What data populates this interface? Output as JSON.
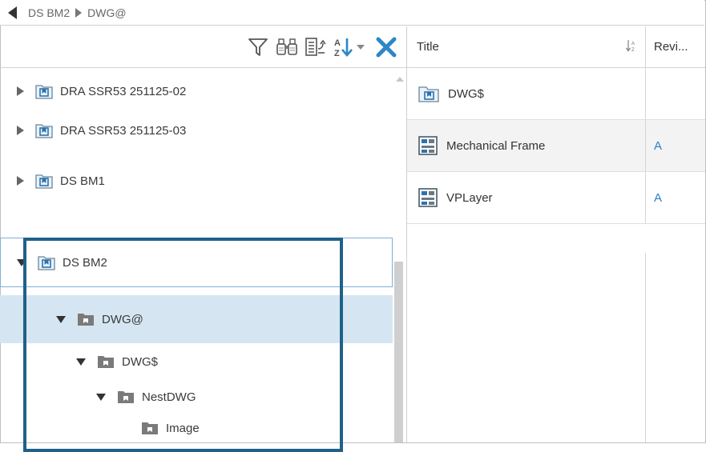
{
  "breadcrumb": {
    "items": [
      "DS BM2",
      "DWG@"
    ]
  },
  "toolbar": {
    "icons": [
      "filter-icon",
      "find-icon",
      "expand-icon",
      "sort-az-icon",
      "clear-icon"
    ]
  },
  "tree": {
    "nodes": [
      {
        "label": "DRA SSR53 251125-02",
        "expanded": false
      },
      {
        "label": "DRA SSR53 251125-03",
        "expanded": false
      },
      {
        "label": "DS BM1",
        "expanded": false
      },
      {
        "label": "DS BM2",
        "expanded": true
      },
      {
        "label": "DWG@",
        "expanded": true
      },
      {
        "label": "DWG$",
        "expanded": true
      },
      {
        "label": "NestDWG",
        "expanded": true
      },
      {
        "label": "Image",
        "expanded": false
      }
    ]
  },
  "grid": {
    "columns": {
      "title": "Title",
      "revision": "Revi..."
    },
    "rows": [
      {
        "title": "DWG$",
        "revision": ""
      },
      {
        "title": "Mechanical Frame",
        "revision": "A"
      },
      {
        "title": "VPLayer",
        "revision": "A"
      }
    ]
  },
  "colors": {
    "selection": "#d5e6f2",
    "highlight_border": "#1f6189",
    "revision_text": "#2a7fc8",
    "clear_icon": "#2d87c7"
  }
}
